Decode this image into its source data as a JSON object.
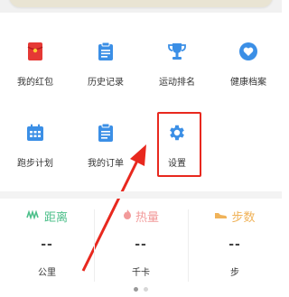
{
  "grid": [
    {
      "label": "我的红包",
      "icon": "red-envelope-icon",
      "color": "#e53935"
    },
    {
      "label": "历史记录",
      "icon": "clipboard-icon",
      "color": "#3b8fe6"
    },
    {
      "label": "运动排名",
      "icon": "trophy-icon",
      "color": "#3b8fe6"
    },
    {
      "label": "健康档案",
      "icon": "heart-icon",
      "color": "#3b8fe6"
    },
    {
      "label": "跑步计划",
      "icon": "calendar-icon",
      "color": "#3b8fe6"
    },
    {
      "label": "我的订单",
      "icon": "order-clipboard-icon",
      "color": "#3b8fe6"
    },
    {
      "label": "设置",
      "icon": "gear-icon",
      "color": "#3b8fe6"
    }
  ],
  "stats": [
    {
      "title": "距离",
      "value": "--",
      "unit": "公里",
      "color": "#4cbf8a",
      "icon": "distance-icon"
    },
    {
      "title": "热量",
      "value": "--",
      "unit": "千卡",
      "color": "#f29a9a",
      "icon": "flame-icon"
    },
    {
      "title": "步数",
      "value": "--",
      "unit": "步",
      "color": "#f0b35a",
      "icon": "shoe-icon"
    }
  ],
  "colors": {
    "highlight": "#e8281e",
    "arrow": "#e8281e"
  }
}
